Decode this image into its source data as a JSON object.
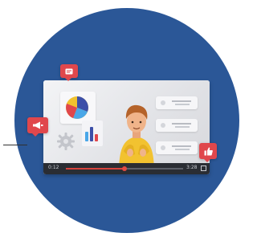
{
  "colors": {
    "background": "#ffffff",
    "circle": "#2b5797",
    "screen": "#e4e5e9",
    "accent_red": "#e0474c",
    "player_bar": "#2a2d33",
    "progress": "#d7423c"
  },
  "icons": {
    "pie_chart": "pie-chart-icon",
    "bar_chart": "bar-chart-icon",
    "gear": "gear-icon",
    "megaphone": "megaphone-icon",
    "message": "message-icon",
    "thumbs_up": "thumbs-up-icon",
    "fullscreen": "fullscreen-icon"
  },
  "player": {
    "elapsed": "0:12",
    "duration": "3:28",
    "progress": 0.5
  }
}
